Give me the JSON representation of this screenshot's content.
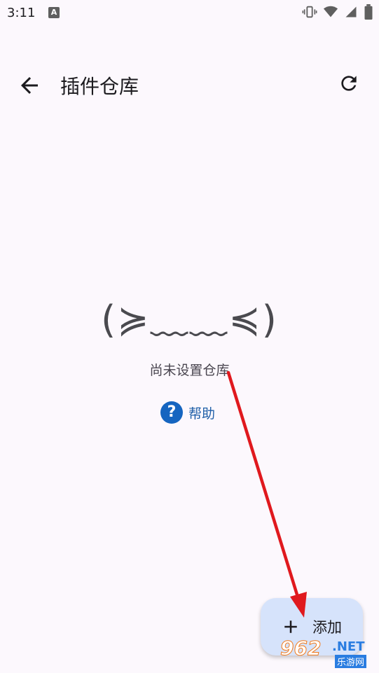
{
  "status_bar": {
    "time": "3:11",
    "notification": "A"
  },
  "app_bar": {
    "title": "插件仓库"
  },
  "empty_state": {
    "kaomoji": "(≽﹏﹏≼)",
    "message": "尚未设置仓库"
  },
  "help": {
    "icon_char": "?",
    "label": "帮助"
  },
  "fab": {
    "label": "添加"
  },
  "watermark": {
    "number": "962",
    "domain": ".NET",
    "site_name": "乐游网"
  },
  "colors": {
    "background": "#fcf8fd",
    "fab": "#d6e3fb",
    "help_icon": "#1565c0",
    "annotation_arrow": "#e0191e"
  }
}
